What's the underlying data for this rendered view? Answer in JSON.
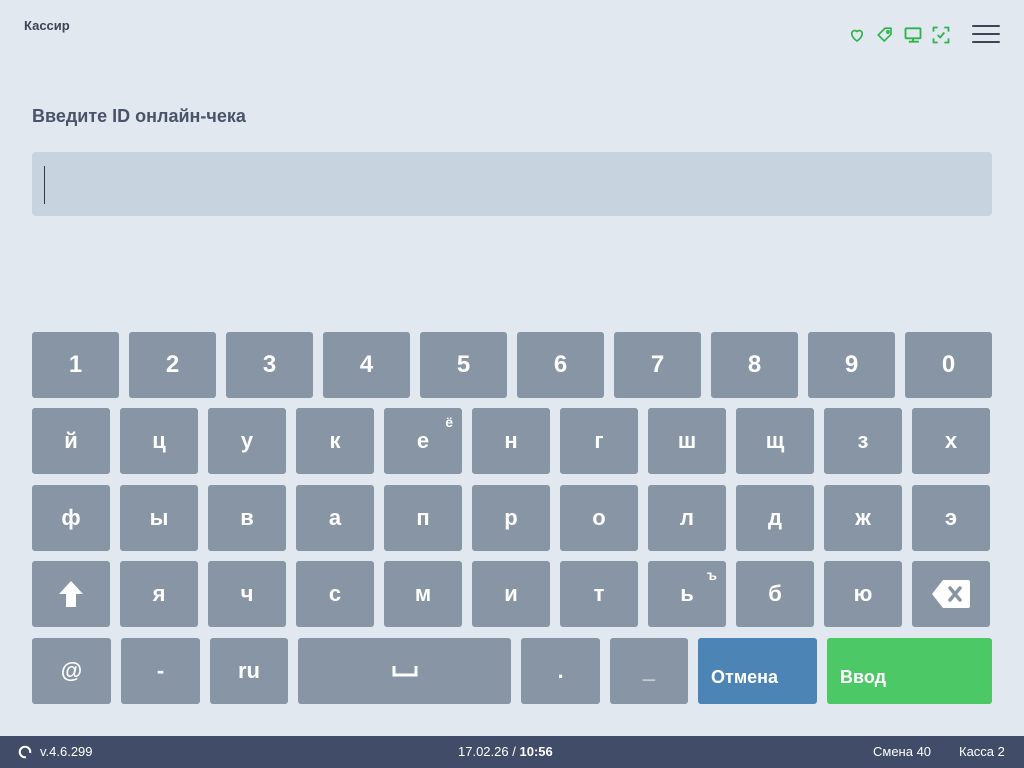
{
  "header": {
    "title": "Кассир",
    "status_icons": [
      "heart-icon",
      "tag-icon",
      "monitor-icon",
      "scan-check-icon"
    ],
    "status_color": "#2fb34a",
    "menu_icon": "hamburger-menu-icon"
  },
  "prompt": {
    "label": "Введите ID онлайн-чека",
    "value": ""
  },
  "keyboard": {
    "row1": [
      "1",
      "2",
      "3",
      "4",
      "5",
      "6",
      "7",
      "8",
      "9",
      "0"
    ],
    "row2": [
      "й",
      "ц",
      "у",
      "к",
      "е",
      "н",
      "г",
      "ш",
      "щ",
      "з",
      "х"
    ],
    "row2_alt": {
      "е": "ё"
    },
    "row3": [
      "ф",
      "ы",
      "в",
      "а",
      "п",
      "р",
      "о",
      "л",
      "д",
      "ж",
      "э"
    ],
    "row4": [
      "⇧",
      "я",
      "ч",
      "с",
      "м",
      "и",
      "т",
      "ь",
      "б",
      "ю",
      "⌫"
    ],
    "row4_alt": {
      "ь": "ъ"
    },
    "row5": {
      "at": "@",
      "dash": "-",
      "lang": "ru",
      "space": "␣",
      "dot": ".",
      "underscore": "_",
      "cancel": "Отмена",
      "enter": "Ввод"
    },
    "colors": {
      "key": "#8795a4",
      "cancel": "#4b84b5",
      "enter": "#4cc866"
    }
  },
  "footer": {
    "version": "v.4.6.299",
    "date": "17.02.26",
    "separator": "/",
    "time": "10:56",
    "shift": "Смена 40",
    "register": "Касса 2"
  }
}
